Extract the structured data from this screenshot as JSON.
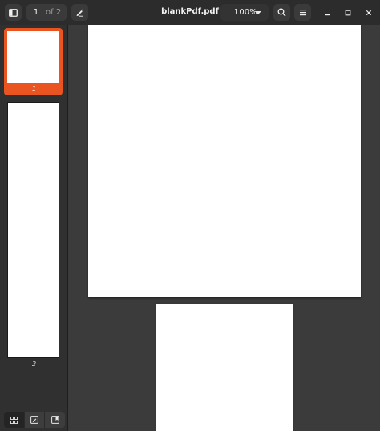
{
  "header": {
    "title": "blankPdf.pdf",
    "current_page": "1",
    "page_of": "of 2",
    "zoom": "100%"
  },
  "sidebar": {
    "thumbnails": [
      {
        "label": "1",
        "selected": true
      },
      {
        "label": "2",
        "selected": false
      }
    ],
    "tabs": [
      {
        "icon": "grid-icon",
        "active": true
      },
      {
        "icon": "annotations-icon",
        "active": false
      },
      {
        "icon": "bookmarks-icon",
        "active": false
      }
    ]
  },
  "colors": {
    "accent": "#e95420",
    "headerbar": "#2c2c2c",
    "doc_background": "#3b3b3b"
  }
}
